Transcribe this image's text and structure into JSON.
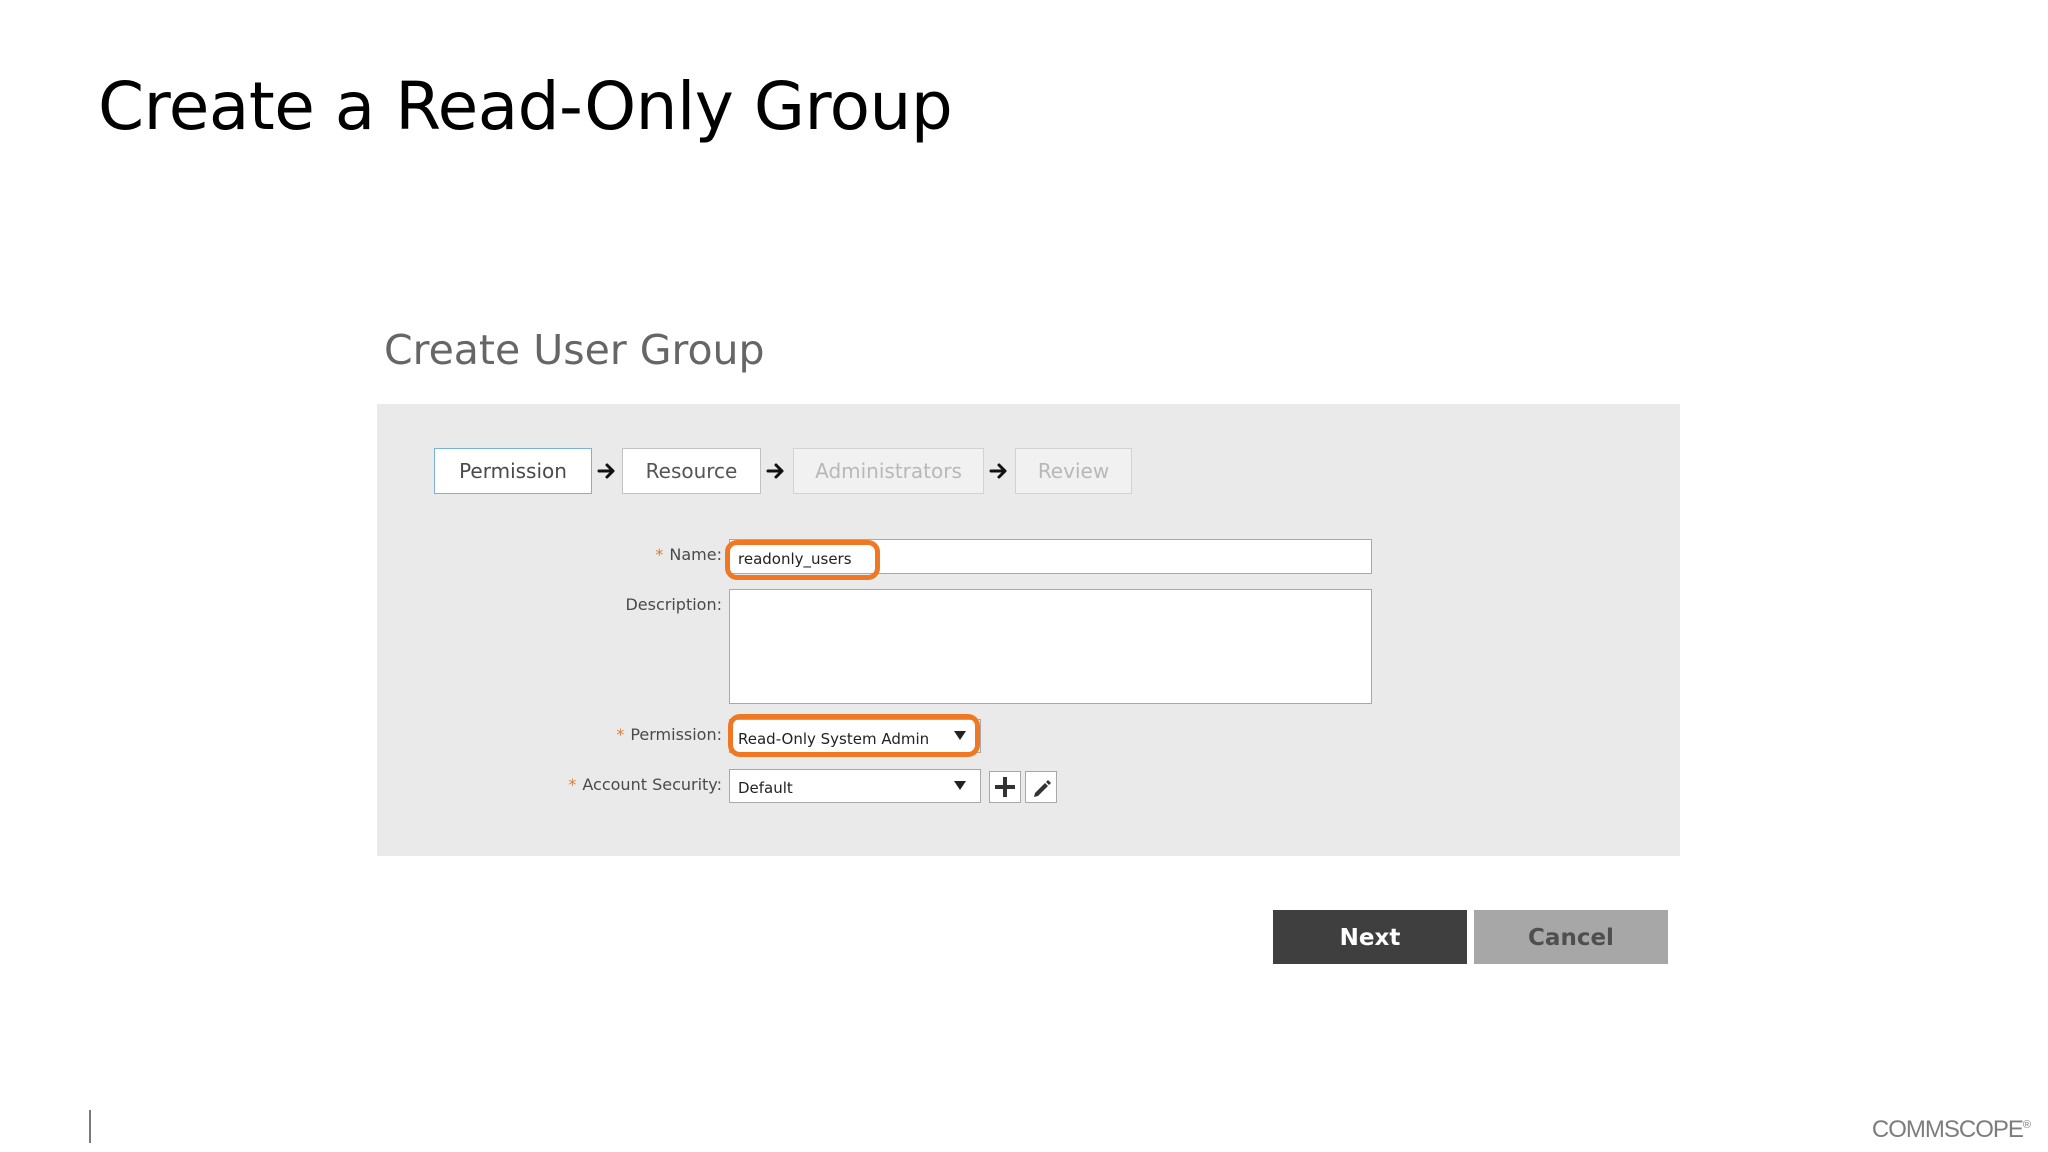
{
  "slide": {
    "title": "Create a Read-Only Group"
  },
  "dialog": {
    "title": "Create User Group"
  },
  "wizard": {
    "steps": [
      {
        "label": "Permission",
        "state": "active"
      },
      {
        "label": "Resource",
        "state": "enabled"
      },
      {
        "label": "Administrators",
        "state": "disabled"
      },
      {
        "label": "Review",
        "state": "disabled"
      }
    ],
    "arrow_icon": "arrow-right-icon"
  },
  "form": {
    "required_marker": "*",
    "name": {
      "label": "Name:",
      "value": "readonly_users",
      "required": true
    },
    "description": {
      "label": "Description:",
      "value": "",
      "required": false
    },
    "permission": {
      "label": "Permission:",
      "value": "Read-Only System Admin",
      "required": true
    },
    "account_security": {
      "label": "Account Security:",
      "value": "Default",
      "required": true,
      "add_icon": "plus-icon",
      "edit_icon": "pencil-icon"
    }
  },
  "actions": {
    "next_label": "Next",
    "cancel_label": "Cancel"
  },
  "footer": {
    "logo_text": "COMMSCOPE",
    "logo_mark": "®"
  },
  "colors": {
    "highlight": "#f07823",
    "required": "#e07b2c",
    "panel_bg": "#eaeaea",
    "next_bg": "#3f3f3f",
    "cancel_bg": "#a7a7a7",
    "active_step_border": "#7ab3d6"
  }
}
